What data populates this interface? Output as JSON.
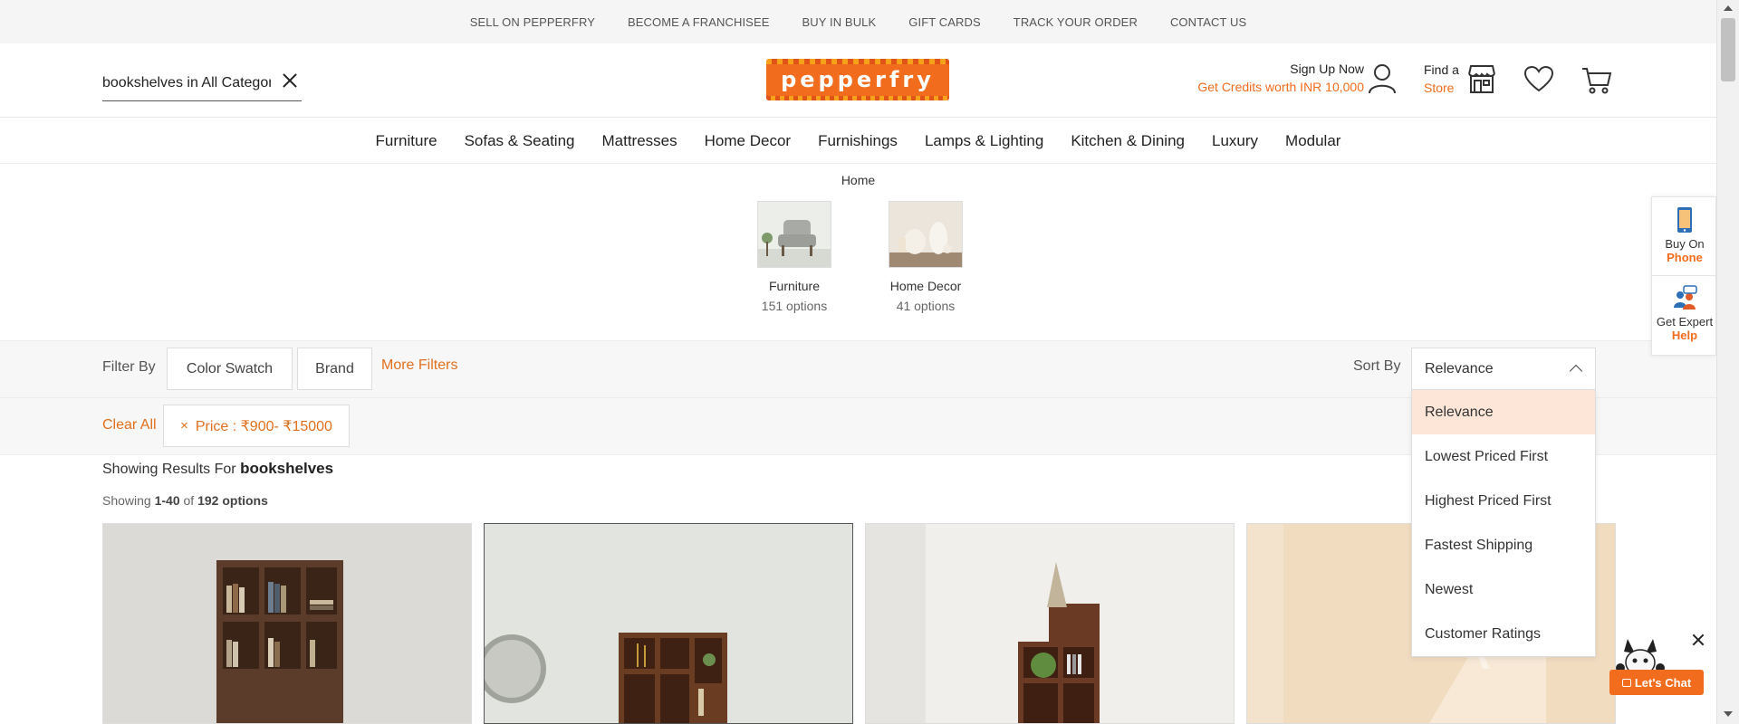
{
  "topbar": {
    "links": [
      "SELL ON PEPPERFRY",
      "BECOME A FRANCHISEE",
      "BUY IN BULK",
      "GIFT CARDS",
      "TRACK YOUR ORDER",
      "CONTACT US"
    ]
  },
  "header": {
    "search_value": "bookshelves in All Categories",
    "logo_text": "pepperfry",
    "signup_label": "Sign Up Now",
    "credits_label": "Get Credits worth INR 10,000",
    "store_label_1": "Find a",
    "store_label_2": "Store",
    "icons": [
      "user-icon",
      "store-icon",
      "heart-icon",
      "cart-icon",
      "close-icon"
    ]
  },
  "nav": {
    "items": [
      "Furniture",
      "Sofas & Seating",
      "Mattresses",
      "Home Decor",
      "Furnishings",
      "Lamps & Lighting",
      "Kitchen & Dining",
      "Luxury",
      "Modular"
    ]
  },
  "breadcrumb": "Home",
  "categories": [
    {
      "name": "Furniture",
      "count": "151 options"
    },
    {
      "name": "Home Decor",
      "count": "41 options"
    }
  ],
  "filters": {
    "label": "Filter By",
    "buttons": [
      "Color Swatch",
      "Brand"
    ],
    "more": "More Filters",
    "clear_all": "Clear All",
    "applied": "Price : ₹900- ₹15000"
  },
  "sort": {
    "label": "Sort By",
    "selected": "Relevance",
    "options": [
      "Relevance",
      "Lowest Priced First",
      "Highest Priced First",
      "Fastest Shipping",
      "Newest",
      "Customer Ratings"
    ]
  },
  "results": {
    "showing_results_for": "Showing Results For",
    "query": "bookshelves",
    "showing_prefix": "Showing",
    "range": "1-40",
    "of": "of",
    "total": "192 options"
  },
  "side_widget": {
    "buy_line1": "Buy On",
    "buy_line2": "Phone",
    "expert_line1": "Get Expert",
    "expert_line2": "Help"
  },
  "chat": {
    "label": "Let's Chat"
  },
  "colors": {
    "accent": "#f26c1d",
    "link_orange": "#e0701e",
    "active_option_bg": "#fde6d8"
  }
}
